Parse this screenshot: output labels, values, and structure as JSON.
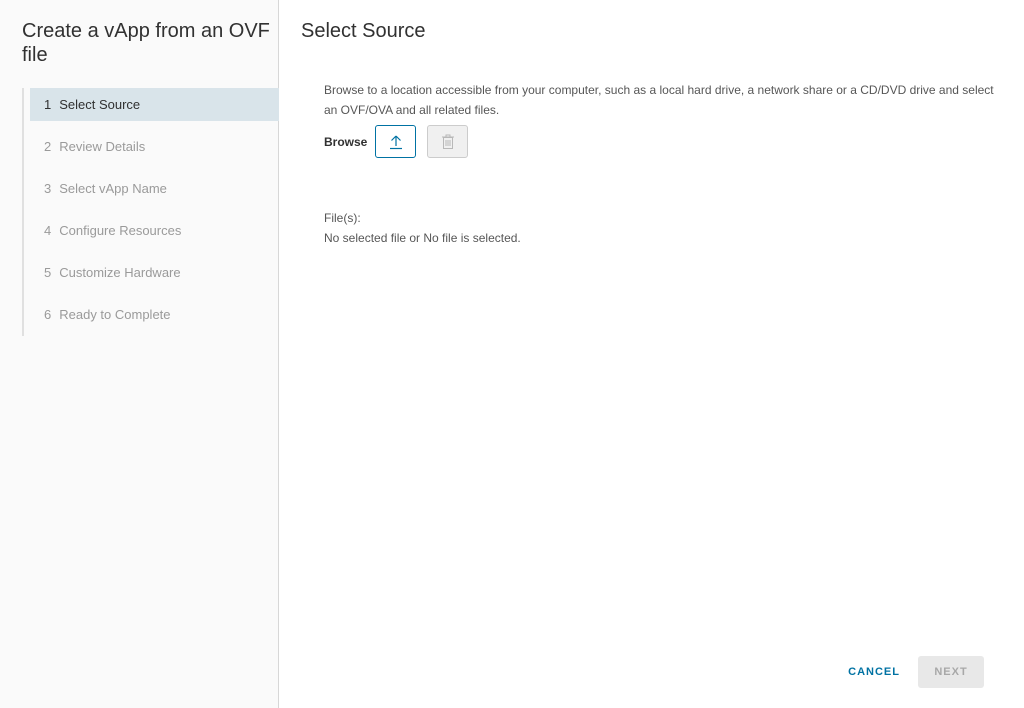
{
  "nav": {
    "title": "Create a vApp from an OVF file",
    "steps": [
      {
        "num": "1",
        "label": "Select Source",
        "state": "active"
      },
      {
        "num": "2",
        "label": "Review Details",
        "state": "disabled"
      },
      {
        "num": "3",
        "label": "Select vApp Name",
        "state": "disabled"
      },
      {
        "num": "4",
        "label": "Configure Resources",
        "state": "disabled"
      },
      {
        "num": "5",
        "label": "Customize Hardware",
        "state": "disabled"
      },
      {
        "num": "6",
        "label": "Ready to Complete",
        "state": "disabled"
      }
    ]
  },
  "main": {
    "title": "Select Source",
    "description": "Browse to a location accessible from your computer, such as a local hard drive, a network share or a CD/DVD drive and select an OVF/OVA and all related files.",
    "browse_label": "Browse",
    "upload_icon": "upload-icon",
    "delete_icon": "trash-icon",
    "files_label": "File(s):",
    "files_value": "No selected file or No file is selected."
  },
  "footer": {
    "cancel_label": "CANCEL",
    "next_label": "NEXT"
  },
  "colors": {
    "accent": "#0072a3",
    "active_step_bg": "#d9e4ea"
  }
}
